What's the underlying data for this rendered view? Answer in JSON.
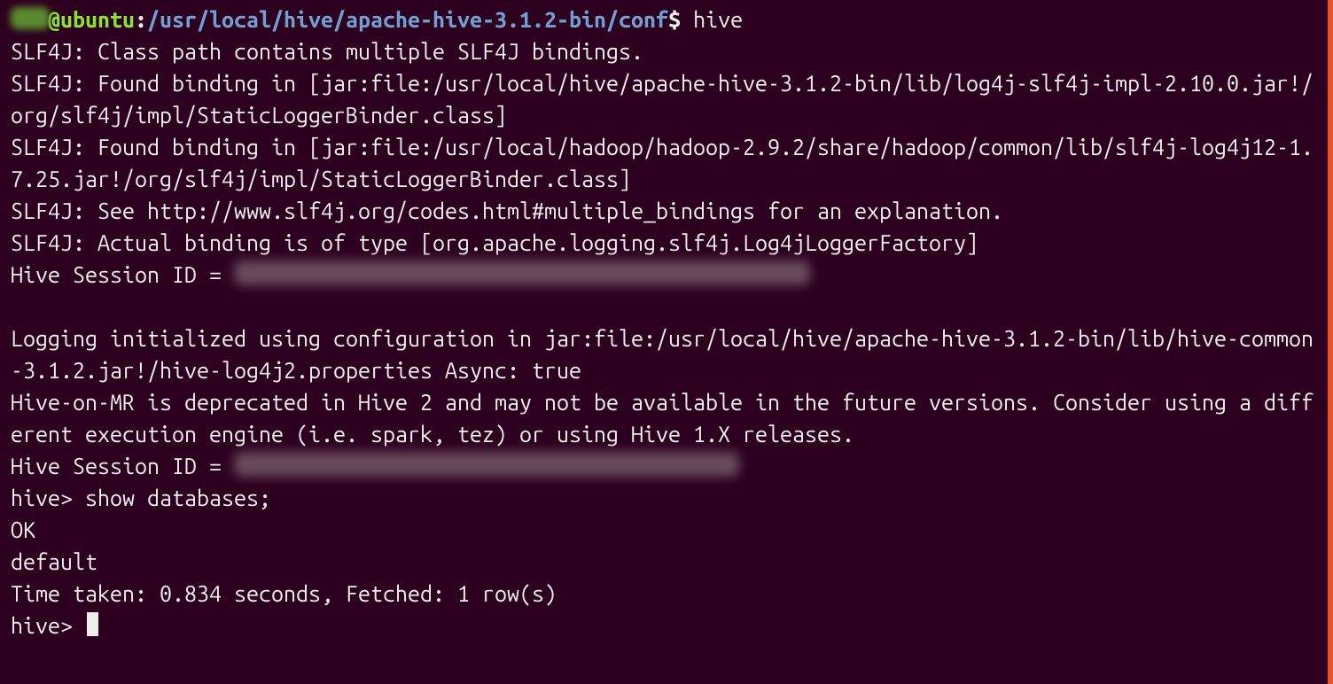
{
  "prompt": {
    "host": "@ubuntu",
    "colon": ":",
    "path": "/usr/local/hive/apache-hive-3.1.2-bin/conf",
    "dollar": "$",
    "command": "hive"
  },
  "output": {
    "l1": "SLF4J: Class path contains multiple SLF4J bindings.",
    "l2": "SLF4J: Found binding in [jar:file:/usr/local/hive/apache-hive-3.1.2-bin/lib/log4j-slf4j-impl-2.10.0.jar!/org/slf4j/impl/StaticLoggerBinder.class]",
    "l3": "SLF4J: Found binding in [jar:file:/usr/local/hadoop/hadoop-2.9.2/share/hadoop/common/lib/slf4j-log4j12-1.7.25.jar!/org/slf4j/impl/StaticLoggerBinder.class]",
    "l4": "SLF4J: See http://www.slf4j.org/codes.html#multiple_bindings for an explanation.",
    "l5": "SLF4J: Actual binding is of type [org.apache.logging.slf4j.Log4jLoggerFactory]",
    "session1_label": "Hive Session ID = ",
    "blank": "",
    "l7": "Logging initialized using configuration in jar:file:/usr/local/hive/apache-hive-3.1.2-bin/lib/hive-common-3.1.2.jar!/hive-log4j2.properties Async: true",
    "l8": "Hive-on-MR is deprecated in Hive 2 and may not be available in the future versions. Consider using a different execution engine (i.e. spark, tez) or using Hive 1.X releases.",
    "session2_label": "Hive Session ID = ",
    "hive_prompt1": "hive> ",
    "hive_cmd1": "show databases;",
    "ok": "OK",
    "db1": "default",
    "time": "Time taken: 0.834 seconds, Fetched: 1 row(s)",
    "hive_prompt2": "hive> "
  }
}
